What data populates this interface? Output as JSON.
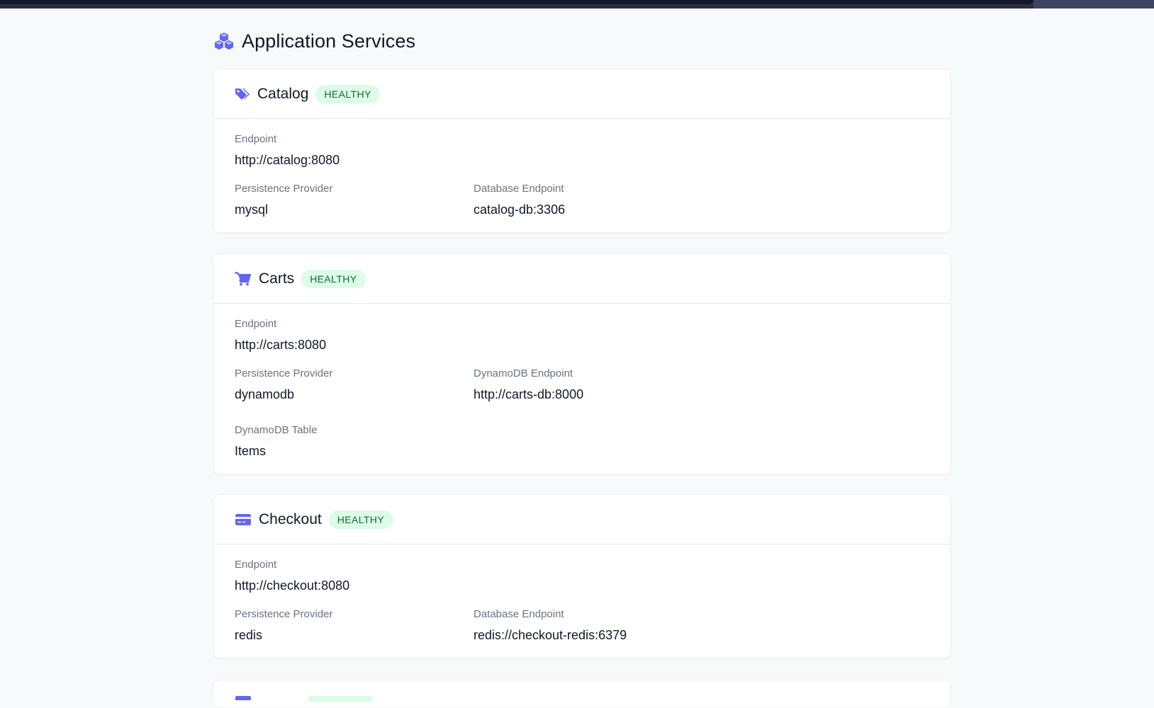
{
  "page": {
    "title": "Application Services",
    "title_icon": "cubes-icon"
  },
  "colors": {
    "accent": "#6366f1",
    "badge_bg": "#dcfce7",
    "badge_text": "#166534",
    "label": "#6b7280"
  },
  "services": [
    {
      "name": "Catalog",
      "icon": "tags-icon",
      "status": "HEALTHY",
      "fields": [
        {
          "label": "Endpoint",
          "value": "http://catalog:8080"
        },
        {
          "label": "Persistence Provider",
          "value": "mysql"
        },
        {
          "label": "Database Endpoint",
          "value": "catalog-db:3306"
        }
      ]
    },
    {
      "name": "Carts",
      "icon": "shopping-cart-icon",
      "status": "HEALTHY",
      "fields": [
        {
          "label": "Endpoint",
          "value": "http://carts:8080"
        },
        {
          "label": "Persistence Provider",
          "value": "dynamodb"
        },
        {
          "label": "DynamoDB Endpoint",
          "value": "http://carts-db:8000"
        },
        {
          "label": "DynamoDB Table",
          "value": "Items"
        }
      ]
    },
    {
      "name": "Checkout",
      "icon": "credit-card-icon",
      "status": "HEALTHY",
      "fields": [
        {
          "label": "Endpoint",
          "value": "http://checkout:8080"
        },
        {
          "label": "Persistence Provider",
          "value": "redis"
        },
        {
          "label": "Database Endpoint",
          "value": "redis://checkout-redis:6379"
        }
      ]
    }
  ]
}
